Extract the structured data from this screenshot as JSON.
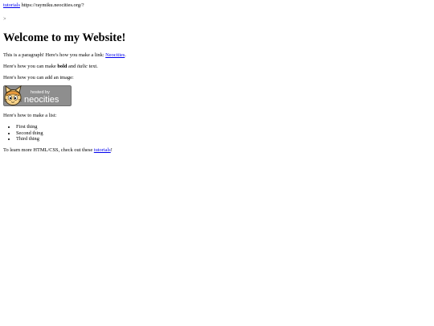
{
  "top": {
    "link_text": "tutorials",
    "url_text": "https://raymiku.neocities.org/?",
    "gt": ">"
  },
  "heading": "Welcome to my Website!",
  "p1": {
    "before": "This is a paragraph! Here's how you make a link: ",
    "link": "Neocities",
    "after": "."
  },
  "p2": {
    "before": "Here's how you can make ",
    "bold": "bold",
    "middle": " and ",
    "italic": "italic",
    "after": " text."
  },
  "p3": "Here's how you can add an image:",
  "badge": {
    "line1": "hosted by",
    "line2": "neocities",
    "bg": "#8e8e8e",
    "icon": "neocities-cat-icon"
  },
  "p4": "Here's how to make a list:",
  "list": [
    "First thing",
    "Second thing",
    "Third thing"
  ],
  "p5": {
    "before": "To learn more HTML/CSS, check out these ",
    "link": "tutorials",
    "after": "!"
  }
}
